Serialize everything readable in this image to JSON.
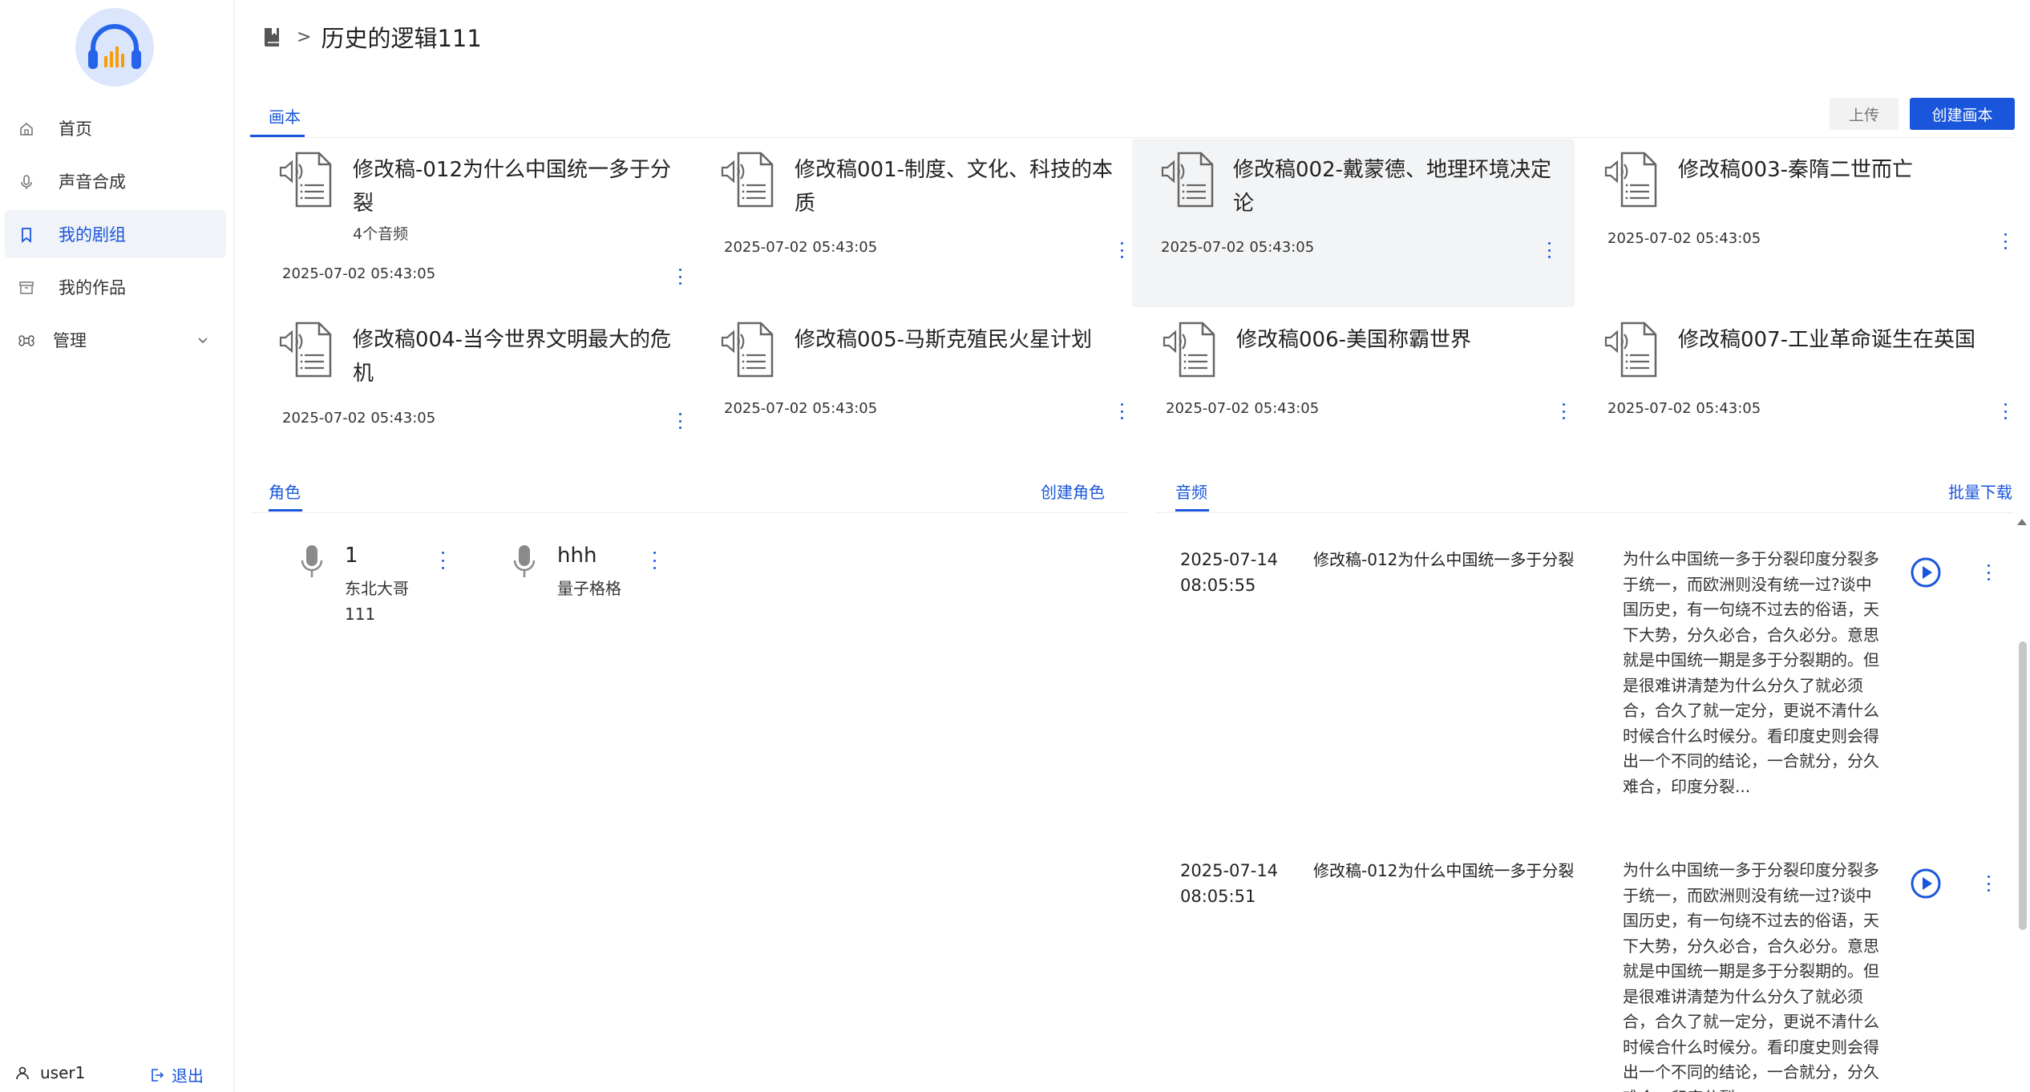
{
  "breadcrumb": {
    "separator": ">",
    "title": "历史的逻辑111"
  },
  "sidebar": {
    "items": [
      {
        "label": "首页",
        "icon": "home-icon",
        "active": false
      },
      {
        "label": "声音合成",
        "icon": "microphone-icon",
        "active": false
      },
      {
        "label": "我的剧组",
        "icon": "bookmark-icon",
        "active": true
      },
      {
        "label": "我的作品",
        "icon": "archive-icon",
        "active": false
      },
      {
        "label": "管理",
        "icon": "command-icon",
        "active": false,
        "expandable": true
      }
    ],
    "user": {
      "name": "user1",
      "logout_label": "退出"
    }
  },
  "books": {
    "tab_label": "画本",
    "upload_label": "上传",
    "create_label": "创建画本",
    "items": [
      {
        "title": "修改稿-012为什么中国统一多于分裂",
        "sub": "4个音频",
        "date": "2025-07-02 05:43:05"
      },
      {
        "title": "修改稿001-制度、文化、科技的本质",
        "sub": "",
        "date": "2025-07-02 05:43:05"
      },
      {
        "title": "修改稿002-戴蒙德、地理环境决定论",
        "sub": "",
        "date": "2025-07-02 05:43:05"
      },
      {
        "title": "修改稿003-秦隋二世而亡",
        "sub": "",
        "date": "2025-07-02 05:43:05"
      },
      {
        "title": "修改稿004-当今世界文明最大的危机",
        "sub": "",
        "date": "2025-07-02 05:43:05"
      },
      {
        "title": "修改稿005-马斯克殖民火星计划",
        "sub": "",
        "date": "2025-07-02 05:43:05"
      },
      {
        "title": "修改稿006-美国称霸世界",
        "sub": "",
        "date": "2025-07-02 05:43:05"
      },
      {
        "title": "修改稿007-工业革命诞生在英国",
        "sub": "",
        "date": "2025-07-02 05:43:05"
      }
    ]
  },
  "roles": {
    "tab_label": "角色",
    "create_label": "创建角色",
    "items": [
      {
        "name": "1",
        "voice": "东北大哥111"
      },
      {
        "name": "hhh",
        "voice": "量子格格"
      }
    ]
  },
  "audio": {
    "tab_label": "音频",
    "batch_download_label": "批量下载",
    "items": [
      {
        "date": "2025-07-14 08:05:55",
        "name": "修改稿-012为什么中国统一多于分裂",
        "text": "为什么中国统一多于分裂印度分裂多于统一，而欧洲则没有统一过?谈中国历史，有一句绕不过去的俗语，天下大势，分久必合，合久必分。意思就是中国统一期是多于分裂期的。但是很难讲清楚为什么分久了就必须合，合久了就一定分，更说不清什么时候合什么时候分。看印度史则会得出一个不同的结论，一合就分，分久难合，印度分裂..."
      },
      {
        "date": "2025-07-14 08:05:51",
        "name": "修改稿-012为什么中国统一多于分裂",
        "text": "为什么中国统一多于分裂印度分裂多于统一，而欧洲则没有统一过?谈中国历史，有一句绕不过去的俗语，天下大势，分久必合，合久必分。意思就是中国统一期是多于分裂期的。但是很难讲清楚为什么分久了就必须合，合久了就一定分，更说不清什么时候合什么时候分。看印度史则会得出一个不同的结论，一合就分，分久难合，印度分裂..."
      }
    ]
  },
  "colors": {
    "accent": "#1a56db",
    "active_bg": "#f0f3f8"
  }
}
